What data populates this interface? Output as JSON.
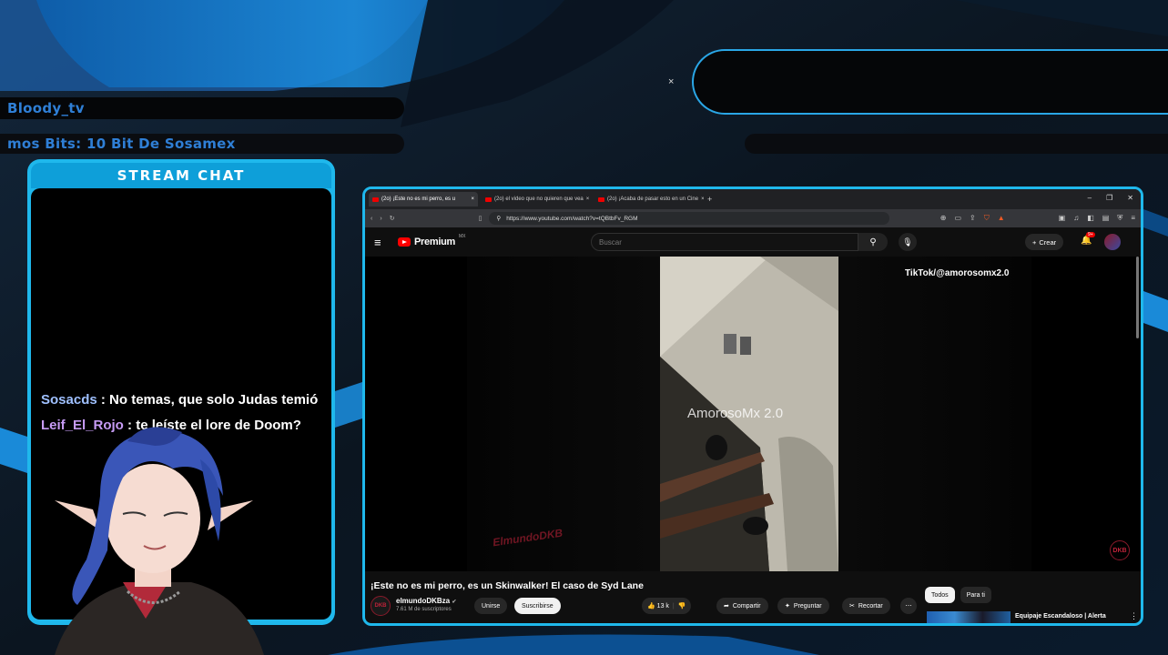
{
  "overlay": {
    "streamer_name": "Bloody_tv",
    "ticker_text": "mos Bits: 10 Bit De Sosamex",
    "chat_title": "STREAM CHAT",
    "close_mark": "×"
  },
  "chat": {
    "messages": [
      {
        "user": "Sosacds",
        "separator": " : ",
        "text": "No temas, que solo Judas temió",
        "user_color": "#9fc0ff"
      },
      {
        "user": "Leif_El_Rojo",
        "separator": " : ",
        "text": "te leíste el lore de Doom?",
        "user_color": "#c79cf5"
      }
    ]
  },
  "browser": {
    "tabs": [
      {
        "label": "(2o) ¡Este no es mi perro, es u",
        "close": "×"
      },
      {
        "label": "(2o) el video que no quieren que vea",
        "close": "×"
      },
      {
        "label": "(2o) ¡Acaba de pasar esto en un Cine",
        "close": "×"
      }
    ],
    "new_tab": "+",
    "window_buttons": [
      "–",
      "❐",
      "✕"
    ],
    "url": "https://www.youtube.com/watch?v=tQBtbFv_RGM"
  },
  "youtube": {
    "brand": "Premium",
    "country": "MX",
    "search_placeholder": "Buscar",
    "create_label": "Crear",
    "notification_badge": "9+",
    "video_overlay_tiktok": "TikTok/@amorosomx2.0",
    "video_overlay_watermark": "AmorosoMx 2.0",
    "video_logo_left": "ElmundoDKB",
    "video_logo_right": "DKB",
    "video_title": "¡Este no es mi perro, es un Skinwalker! El caso de Syd Lane",
    "channel_name": "elmundoDKBza",
    "channel_verified": "✔",
    "channel_subs": "7.61 M de suscriptores",
    "channel_avatar_text": "DKB",
    "join_label": "Unirse",
    "subscribe_label": "Suscribirse",
    "likes": "13 k",
    "share_label": "Compartir",
    "ask_label": "Preguntar",
    "clip_label": "Recortar",
    "chips": [
      "Todos",
      "Para ti"
    ],
    "related_title": "Equipaje Escandaloso | Alerta"
  },
  "colors": {
    "accent": "#1fb8ec",
    "overlay_text": "#2f7fd6",
    "youtube_red": "#ff0000"
  }
}
